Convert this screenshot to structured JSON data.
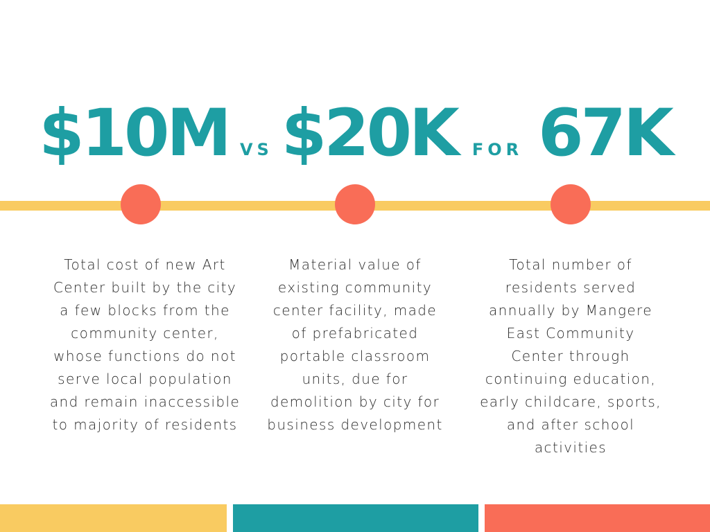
{
  "headline": {
    "amount_1": "$10M",
    "connector_1": "VS",
    "amount_2": "$20K",
    "connector_2": "FOR",
    "amount_3": "67K"
  },
  "columns": [
    {
      "lines": [
        "Total cost of new Art",
        "Center built by the city",
        "a few blocks from the",
        "community center,",
        "whose functions do not",
        "serve local population",
        "and remain inaccessible",
        "to majority of residents"
      ]
    },
    {
      "lines": [
        "Material value of",
        "existing community",
        "center facility, made",
        "of prefabricated",
        "portable classroom",
        "units, due for",
        "demolition by city for",
        "business development"
      ]
    },
    {
      "lines": [
        "Total number of",
        "residents served",
        "annually by Mangere",
        "East Community",
        "Center through",
        "continuing education,",
        "early childcare, sports,",
        "and after school",
        "activities"
      ]
    }
  ],
  "colors": {
    "teal": "#1e9ea3",
    "yellow": "#f9cb61",
    "coral": "#f96d57",
    "text": "#2b2b2b"
  }
}
